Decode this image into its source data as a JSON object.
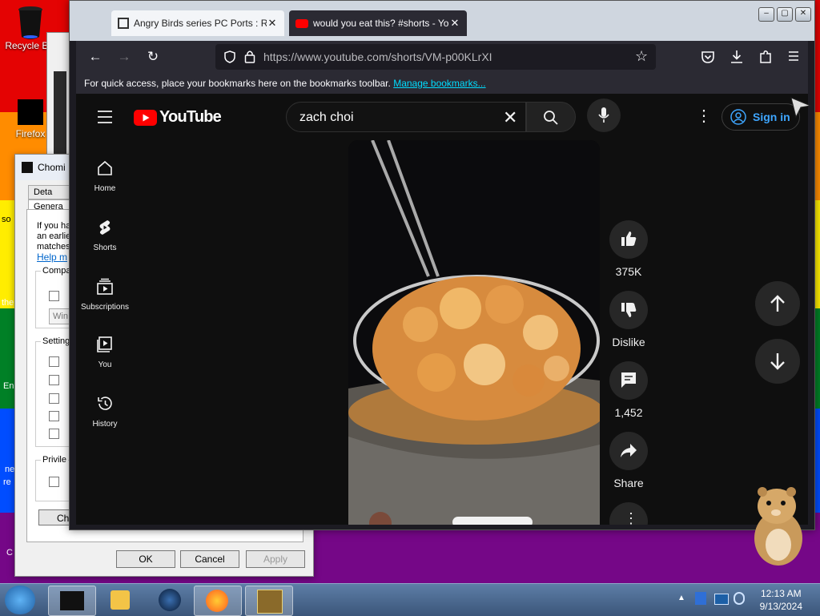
{
  "desktop": {
    "icons": [
      {
        "label": "Recycle Bin",
        "icon": "recycle-bin-icon"
      },
      {
        "label": "Firefox",
        "icon": "firefox-icon"
      }
    ],
    "partial_labels": [
      "so",
      "the",
      "En",
      "ne",
      "re",
      "C"
    ]
  },
  "dialog": {
    "title": "Chomi",
    "tabs": [
      "Deta",
      "Genera"
    ],
    "intro_lines": [
      "If you ha",
      "an earlie",
      "matches"
    ],
    "help_link": "Help m",
    "groups": [
      {
        "label": "Compa"
      },
      {
        "label": "Setting"
      },
      {
        "label": "Privile"
      }
    ],
    "compat_select": "Win",
    "change_button": "Cha",
    "buttons": {
      "ok": "OK",
      "cancel": "Cancel",
      "apply": "Apply"
    }
  },
  "browser": {
    "tabs": [
      {
        "title": "Angry Birds series PC Ports : Ro",
        "icon": "archive-icon",
        "active": false
      },
      {
        "title": "would you eat this? #shorts - Yo",
        "icon": "youtube-icon",
        "active": true
      }
    ],
    "url": "https://www.youtube.com/shorts/VM-p00KLrXI",
    "bookmarks_bar": {
      "text": "For quick access, place your bookmarks here on the bookmarks toolbar.",
      "link": "Manage bookmarks..."
    }
  },
  "youtube": {
    "logo_text": "YouTube",
    "search_query": "zach choi",
    "sign_in": "Sign in",
    "sidebar": [
      {
        "label": "Home",
        "icon": "home-icon"
      },
      {
        "label": "Shorts",
        "icon": "shorts-icon"
      },
      {
        "label": "Subscriptions",
        "icon": "subscriptions-icon"
      },
      {
        "label": "You",
        "icon": "you-icon"
      },
      {
        "label": "History",
        "icon": "history-icon"
      }
    ],
    "actions": {
      "like_count": "375K",
      "dislike": "Dislike",
      "comments_count": "1,452",
      "share": "Share"
    }
  },
  "taskbar": {
    "time": "12:13 AM",
    "date": "9/13/2024",
    "pinned": [
      "start-orb-icon",
      "terminal-icon",
      "media-player-icon",
      "globe-icon",
      "firefox-icon",
      "bonzi-box-icon"
    ]
  },
  "colors": {
    "youtube_red": "#ff0000",
    "yt_bg": "#0f0f0f",
    "link_blue": "#3ea6ff",
    "firefox_bar": "#2b2a33"
  }
}
